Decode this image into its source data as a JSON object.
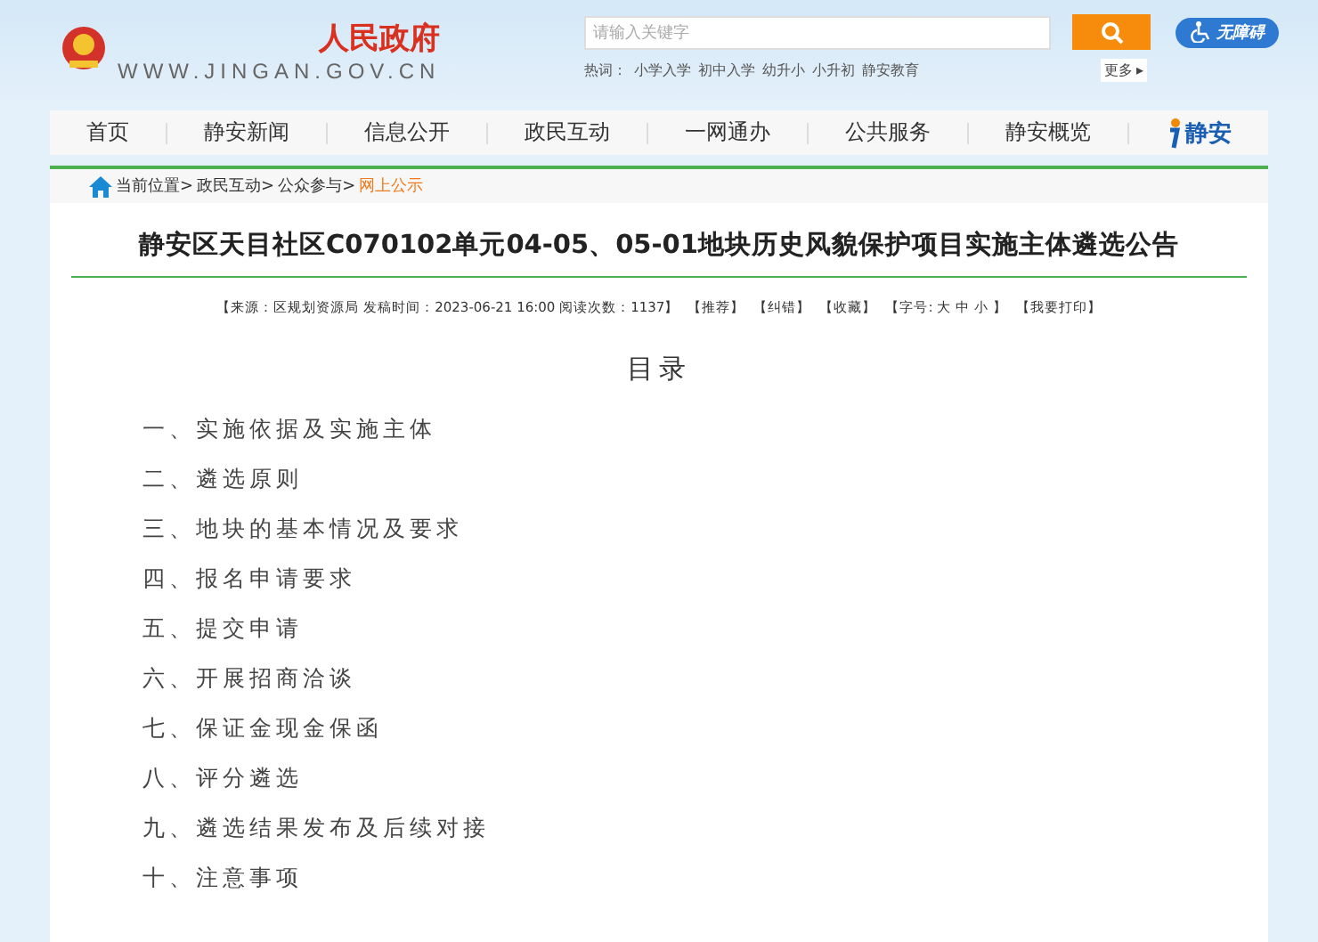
{
  "header": {
    "logo_text": "人民政府",
    "url": "WWW.JINGAN.GOV.CN",
    "search": {
      "placeholder": "请输入关键字"
    },
    "accessibility": "无障碍",
    "hot_label": "热词：",
    "hot_words": [
      "小学入学",
      "初中入学",
      "幼升小",
      "小升初",
      "静安教育"
    ],
    "more": "更多 ▸"
  },
  "nav": {
    "items": [
      "首页",
      "静安新闻",
      "信息公开",
      "政民互动",
      "一网通办",
      "公共服务",
      "静安概览"
    ],
    "brand": "静安"
  },
  "breadcrumb": [
    {
      "label": "当前位置>",
      "selected": false
    },
    {
      "label": "政民互动>",
      "selected": false
    },
    {
      "label": "公众参与>",
      "selected": false
    },
    {
      "label": "网上公示",
      "selected": true
    }
  ],
  "article": {
    "title": "静安区天目社区C070102单元04-05、05-01地块历史风貌保护项目实施主体遴选公告",
    "meta": [
      "【来源：区规划资源局  发稿时间：2023-06-21 16:00 阅读次数：1137】",
      "【推荐】",
      "【纠错】",
      "【收藏】",
      "【字号: 大 中 小 】",
      "【我要打印】"
    ],
    "toc_title": "目录",
    "toc": [
      "一、实施依据及实施主体",
      "二、遴选原则",
      "三、地块的基本情况及要求",
      "四、报名申请要求",
      "五、提交申请",
      "六、开展招商洽谈",
      "七、保证金现金保函",
      "八、评分遴选",
      "九、遴选结果发布及后续对接",
      "十、注意事项"
    ]
  }
}
